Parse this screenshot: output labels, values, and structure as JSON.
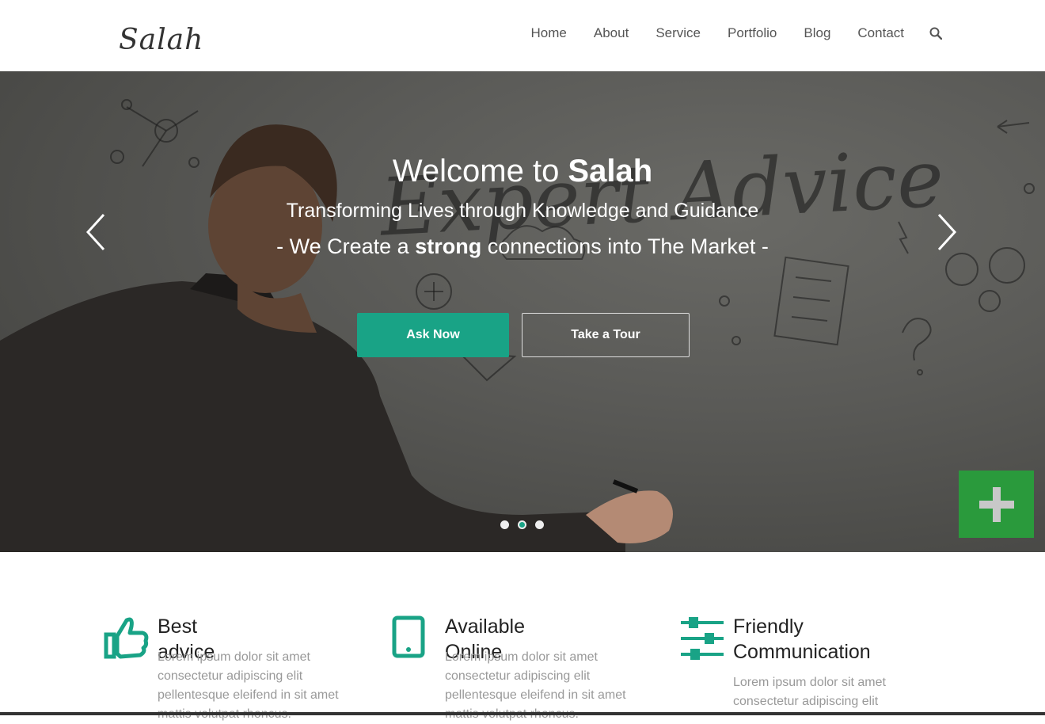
{
  "header": {
    "logo": "Salah",
    "nav": [
      "Home",
      "About",
      "Service",
      "Portfolio",
      "Blog",
      "Contact"
    ],
    "search_icon": "search-icon"
  },
  "hero": {
    "board_text": "Expert Advice",
    "title_prefix": "Welcome to ",
    "title_bold": "Salah",
    "subtitle": "Transforming Lives through Knowledge and Guidance",
    "tagline_prefix": "- We Create a ",
    "tagline_bold": "strong",
    "tagline_suffix": " connections into The Market -",
    "primary_button": "Ask Now",
    "secondary_button": "Take a Tour",
    "slides_total": 3,
    "active_slide": 2
  },
  "features": [
    {
      "icon": "thumbs-up-icon",
      "title": "Best advice",
      "text": "Lorem ipsum dolor sit amet consectetur adipiscing elit pellentesque eleifend in sit amet mattis volutpat rhoncus."
    },
    {
      "icon": "tablet-icon",
      "title": "Available Online",
      "text": "Lorem ipsum dolor sit amet consectetur adipiscing elit pellentesque eleifend in sit amet mattis volutpat rhoncus."
    },
    {
      "icon": "sliders-icon",
      "title_line1": "Friendly",
      "title_line2": "Communication",
      "text": "Lorem ipsum dolor sit amet consectetur adipiscing elit"
    }
  ],
  "colors": {
    "accent": "#19a386",
    "plus_button": "#2a9a3c"
  }
}
